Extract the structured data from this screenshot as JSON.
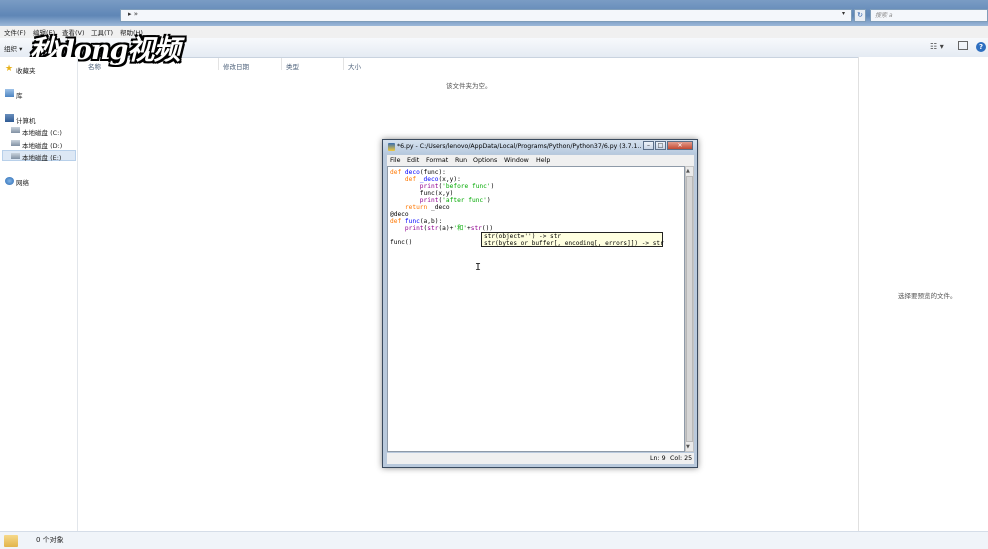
{
  "explorer": {
    "address_arrow": "▸ »",
    "address_dropdown": "▾",
    "refresh_glyph": "↻",
    "search_placeholder": "搜索 a",
    "menu": [
      "文件(F)",
      "编辑(E)",
      "查看(V)",
      "工具(T)",
      "帮助(H)"
    ],
    "organize_label": "组织 ▾",
    "view_glyph": "☷ ▾",
    "help_glyph": "?",
    "logo_text": "秒dong视频",
    "nav": {
      "favorites": "收藏夹",
      "libraries": "库",
      "computer": "计算机",
      "drive_c": "本地磁盘 (C:)",
      "drive_d": "本地磁盘 (D:)",
      "drive_e": "本地磁盘 (E:)",
      "network": "网络"
    },
    "columns": {
      "name": "名称",
      "modified": "修改日期",
      "type": "类型",
      "size": "大小"
    },
    "empty_message": "该文件夹为空。",
    "preview_message": "选择要预览的文件。",
    "status_text": "0 个对象"
  },
  "idle": {
    "title": "*6.py - C:/Users/lenovo/AppData/Local/Programs/Python/Python37/6.py (3.7.1...",
    "btn_min": "–",
    "btn_max": "□",
    "btn_close": "✕",
    "menu": [
      "File",
      "Edit",
      "Format",
      "Run",
      "Options",
      "Window",
      "Help"
    ],
    "code": {
      "l1_kw": "def ",
      "l1_fn": "deco",
      "l1_rest": "(func):",
      "l2_kw": "    def ",
      "l2_fn": "_deco",
      "l2_rest": "(x,y):",
      "l3_bi": "        print",
      "l3_p1": "(",
      "l3_st": "'before func'",
      "l3_p2": ")",
      "l4": "        func(x,y)",
      "l5_bi": "        print",
      "l5_p1": "(",
      "l5_st": "'after func'",
      "l5_p2": ")",
      "l6_kw": "    return",
      "l6_rest": " _deco",
      "l7": "@deco",
      "l8_kw": "def ",
      "l8_fn": "func",
      "l8_rest": "(a,b):",
      "l9_bi": "    print",
      "l9_a": "(",
      "l9_bi2": "str",
      "l9_b": "(a)+",
      "l9_st": "'和'",
      "l9_c": "+",
      "l9_bi3": "str",
      "l9_d": "())",
      "l11": "func()"
    },
    "calltip_line1": "str(object='') -> str",
    "calltip_line2": "str(bytes_or_buffer[, encoding[, errors]]) -> str",
    "status_ln": "Ln: 9",
    "status_col": "Col: 25",
    "cursor_glyph": "I"
  }
}
